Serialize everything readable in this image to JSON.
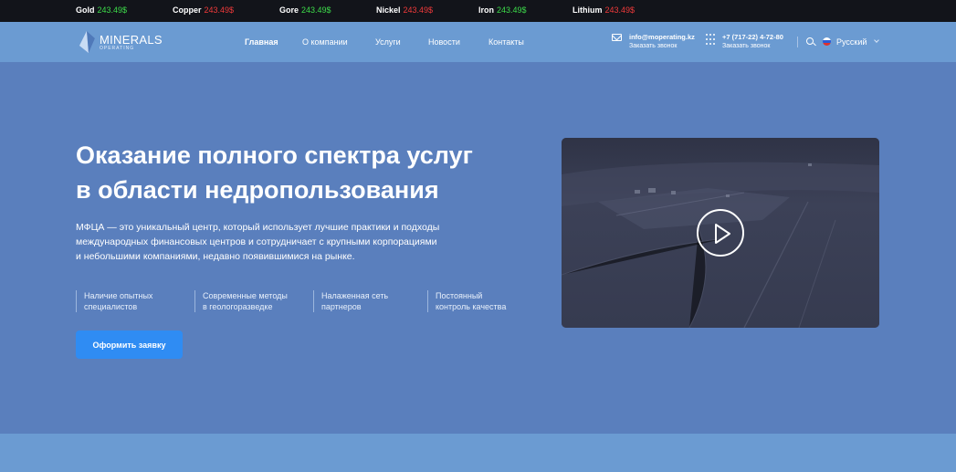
{
  "ticker": [
    {
      "name": "Gold",
      "price": "243.49$",
      "trend": "up"
    },
    {
      "name": "Copper",
      "price": "243.49$",
      "trend": "down"
    },
    {
      "name": "Gore",
      "price": "243.49$",
      "trend": "up"
    },
    {
      "name": "Nickel",
      "price": "243.49$",
      "trend": "down"
    },
    {
      "name": "Iron",
      "price": "243.49$",
      "trend": "up"
    },
    {
      "name": "Lithium",
      "price": "243.49$",
      "trend": "down"
    }
  ],
  "header": {
    "logo_main": "MINERALS",
    "logo_sub": "OPERATING",
    "nav": [
      {
        "label": "Главная",
        "active": true
      },
      {
        "label": "О компании",
        "active": false
      },
      {
        "label": "Услуги",
        "active": false
      },
      {
        "label": "Новости",
        "active": false
      },
      {
        "label": "Контакты",
        "active": false
      }
    ],
    "email": "info@moperating.kz",
    "email_sub": "Заказать звонок",
    "phone": "+7 (717-22) 4-72-80",
    "phone_sub": "Заказать звонок",
    "language": "Русский"
  },
  "hero": {
    "title_lines": [
      "Оказание полного спектра услуг",
      "в области недропользования"
    ],
    "description_lines": [
      "МФЦА — это уникальный центр, который использует лучшие практики и подходы",
      "международных финансовых центров и сотрудничает с крупными корпорациями",
      "и небольшими компаниями, недавно появившимися на рынке."
    ],
    "features": [
      {
        "line1": "Наличие опытных",
        "line2": "специалистов"
      },
      {
        "line1": "Современные методы",
        "line2": "в геологоразведке"
      },
      {
        "line1": "Налаженная сеть",
        "line2": "партнеров"
      },
      {
        "line1": "Постоянный",
        "line2": "контроль качества"
      }
    ],
    "cta_label": "Оформить заявку"
  },
  "colors": {
    "ticker_bg": "#12141a",
    "up": "#3ddc4a",
    "down": "#f03a3a",
    "header_bg": "#6b9bd2",
    "hero_bg": "#5a7fbd",
    "cta_bg": "#2f8cf3"
  }
}
